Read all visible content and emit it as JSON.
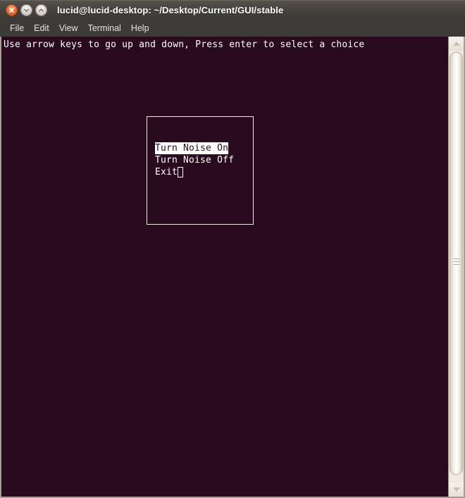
{
  "window": {
    "title": "lucid@lucid-desktop: ~/Desktop/Current/GUI/stable",
    "controls": [
      {
        "name": "close",
        "label": "x",
        "icon": "close-icon",
        "color": "#e8703a"
      },
      {
        "name": "minimize",
        "label": "",
        "icon": "chevron-down-icon",
        "color": "#ddd9d2"
      },
      {
        "name": "maximize",
        "label": "",
        "icon": "chevron-up-icon",
        "color": "#ddd9d2"
      }
    ],
    "colors": {
      "titlebar": "#47443f",
      "menubar": "#3c3b37",
      "terminal_bg": "#2a0a1e",
      "terminal_fg": "#ffffff",
      "border": "#a79f8e",
      "close_button": "#e8703a"
    }
  },
  "menubar": {
    "items": [
      {
        "label": "File"
      },
      {
        "label": "Edit"
      },
      {
        "label": "View"
      },
      {
        "label": "Terminal"
      },
      {
        "label": "Help"
      }
    ]
  },
  "terminal": {
    "instruction_line": "Use arrow keys to go up and down, Press enter to select a choice",
    "dialog": {
      "choices": [
        {
          "label": "Turn Noise On",
          "selected": true
        },
        {
          "label": "Turn Noise Off",
          "selected": false
        },
        {
          "label": "Exit",
          "selected": false
        }
      ],
      "cursor_after": "Exit"
    }
  },
  "scrollbar": {
    "up_arrow": "scroll-up-icon",
    "down_arrow": "scroll-down-icon",
    "grip": "scrollbar-grip"
  }
}
